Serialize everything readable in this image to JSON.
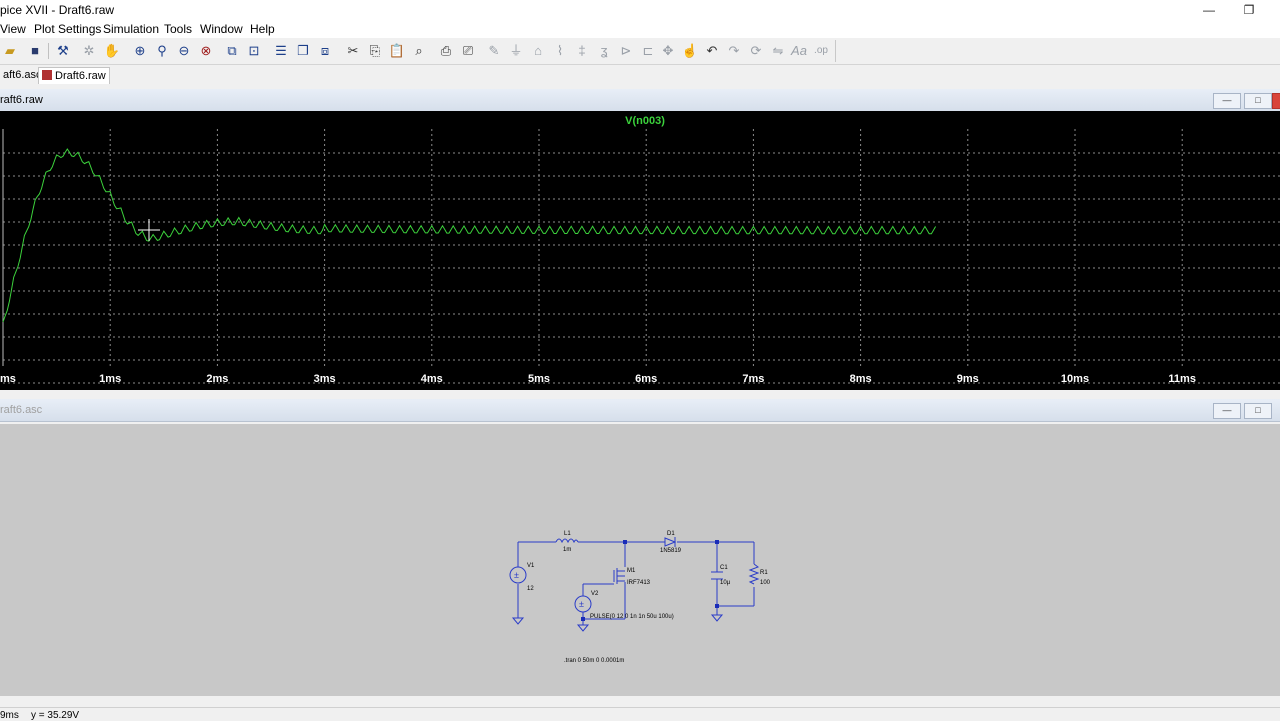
{
  "app": {
    "title": "pice XVII - Draft6.raw",
    "window_buttons": {
      "minimize": "—",
      "restore": "❐"
    }
  },
  "menu": [
    "View",
    "Plot Settings",
    "Simulation",
    "Tools",
    "Window",
    "Help"
  ],
  "toolbar": {
    "icons": [
      "open-icon",
      "save-icon",
      "control-panel-icon",
      "autorange-icon",
      "pan-icon",
      "zoom-in-icon",
      "zoom-area-icon",
      "zoom-out-icon",
      "zoom-cancel-icon",
      "autoscale-icon",
      "fit-icon",
      "tile-horizontal-icon",
      "tile-vertical-icon",
      "cascade-icon",
      "cut-icon",
      "copy-icon",
      "paste-icon",
      "find-icon",
      "print-icon",
      "print-setup-icon",
      "wire-icon",
      "ground-icon",
      "label-icon",
      "resistor-icon",
      "capacitor-icon",
      "inductor-icon",
      "diode-icon",
      "component-icon",
      "move-icon",
      "drag-icon",
      "undo-icon",
      "redo-icon",
      "rotate-icon",
      "mirror-icon",
      "text-icon",
      "spice-directive-icon"
    ]
  },
  "tabs": [
    {
      "label": "aft6.asc",
      "active": false
    },
    {
      "label": "Draft6.raw",
      "active": true
    }
  ],
  "waveform_window": {
    "title": "raft6.raw",
    "trace_name": "V(n003)",
    "trace_color": "#3cd23c",
    "background": "#000000",
    "grid_color": "#8c8c8c",
    "x_ticks": [
      "ms",
      "1ms",
      "2ms",
      "3ms",
      "4ms",
      "5ms",
      "6ms",
      "7ms",
      "8ms",
      "9ms",
      "10ms",
      "11ms",
      "1"
    ],
    "buttons": {
      "minimize": "—",
      "maximize": "□"
    }
  },
  "chart_data": {
    "type": "line",
    "title": "",
    "xlabel": "",
    "ylabel": "",
    "grid": true,
    "series": [
      {
        "name": "V(n003)",
        "color": "#3cd23c"
      }
    ],
    "x_unit": "ms",
    "x_range": [
      0,
      11.9
    ],
    "x_extent_of_data": [
      0,
      8.7
    ],
    "envelope": {
      "description_points_ms": [
        0,
        0.3,
        0.6,
        1.0,
        1.4,
        2.0,
        3.0,
        8.7
      ],
      "peak_value": 35.29
    },
    "cursor_readout": {
      "x": "9ms",
      "y": "35.29V"
    }
  },
  "schematic_window": {
    "title": "raft6.asc",
    "buttons": {
      "minimize": "—",
      "maximize": "□"
    },
    "components": {
      "L1": {
        "name": "L1",
        "value": "1m"
      },
      "D1": {
        "name": "D1",
        "value": "1N5819"
      },
      "M1": {
        "name": "M1",
        "value": "IRF7413"
      },
      "V1": {
        "name": "V1",
        "value": "12"
      },
      "V2": {
        "name": "V2",
        "value": "PULSE(0 12 0 1n 1n 50u 100u)"
      },
      "C1": {
        "name": "C1",
        "value": "10µ"
      },
      "R1": {
        "name": "R1",
        "value": "100"
      }
    },
    "directive": ".tran 0 50m 0 0.0001m",
    "wire_color": "#2a3cc8",
    "node_color": "#1a2cb8"
  },
  "status": {
    "x": "9ms",
    "y": "y = 35.29V"
  }
}
